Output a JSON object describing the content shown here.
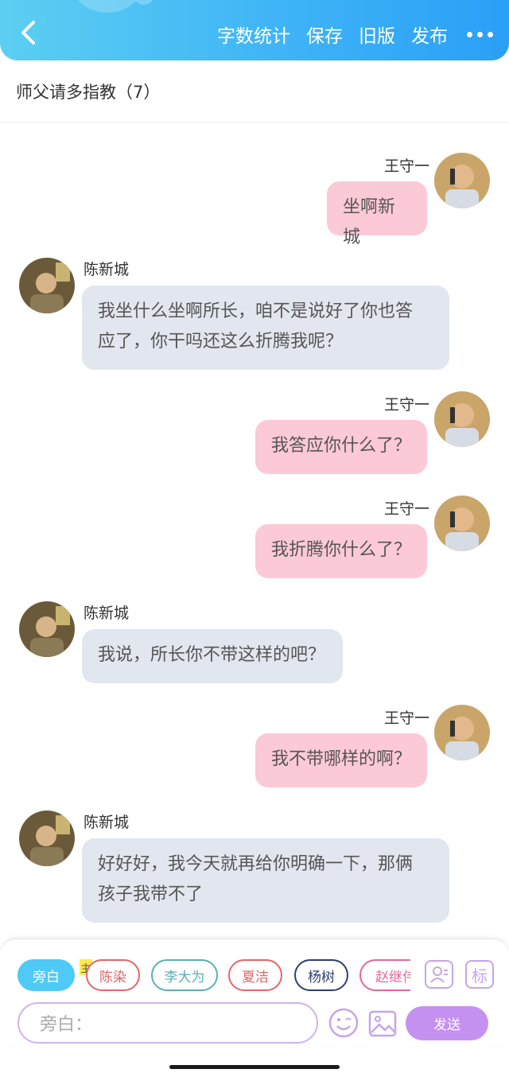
{
  "header": {
    "actions": [
      "字数统计",
      "保存",
      "旧版",
      "发布"
    ]
  },
  "title": "师父请多指教（7）",
  "characters": {
    "wang": "王守一",
    "chen": "陈新城"
  },
  "messages": [
    {
      "speaker": "王守一",
      "side": "right",
      "lines": [
        "坐啊新城"
      ]
    },
    {
      "speaker": "陈新城",
      "side": "left",
      "lines": [
        "我坐什么坐啊所长，咱不是说好了你也答",
        "应了，你干吗还这么折腾我呢？"
      ]
    },
    {
      "speaker": "王守一",
      "side": "right",
      "lines": [
        "我答应你什么了？"
      ]
    },
    {
      "speaker": "王守一",
      "side": "right",
      "lines": [
        "我折腾你什么了？"
      ]
    },
    {
      "speaker": "陈新城",
      "side": "left",
      "lines": [
        "我说，所长你不带这样的吧？"
      ]
    },
    {
      "speaker": "王守一",
      "side": "right",
      "lines": [
        "我不带哪样的啊？"
      ]
    },
    {
      "speaker": "陈新城",
      "side": "left",
      "lines": [
        "好好好，我今天就再给你明确一下，那俩",
        "孩子我带不了"
      ]
    }
  ],
  "role_bar": {
    "main_badge": "主",
    "roles": [
      {
        "label": "旁白",
        "color": "#4fc9f5",
        "active": true
      },
      {
        "label": "陈染",
        "color": "#e0676a",
        "active": false
      },
      {
        "label": "李大为",
        "color": "#5ab0b3",
        "active": false
      },
      {
        "label": "夏洁",
        "color": "#e0676a",
        "active": false
      },
      {
        "label": "杨树",
        "color": "#2f3e73",
        "active": false
      },
      {
        "label": "赵继伟",
        "color": "#e4679a",
        "active": false
      }
    ],
    "tag_icon_text": "标"
  },
  "composer": {
    "placeholder": "旁白：",
    "send_label": "发送"
  },
  "colors": {
    "header_start": "#5ccff2",
    "header_end": "#2a9ff6",
    "bubble_right": "#fcc9d6",
    "bubble_left": "#e2e6ee",
    "send_button": "#c591f0"
  }
}
